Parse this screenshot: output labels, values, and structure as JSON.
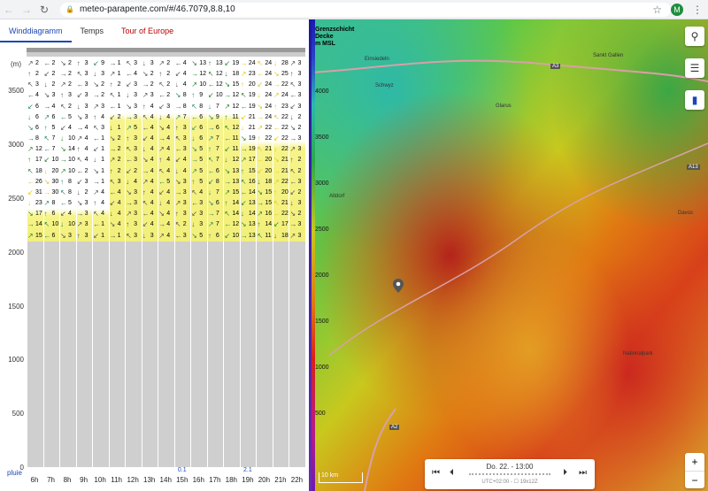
{
  "browser": {
    "url": "meteo-parapente.com/#/46.7079,8.8,10",
    "avatar_letter": "M"
  },
  "tabs": [
    {
      "label": "Winddiagramm",
      "active": true
    },
    {
      "label": "Temps",
      "active": false
    },
    {
      "label": "Tour of Europe",
      "active": false
    }
  ],
  "diagram": {
    "unit": "(m)",
    "y_ticks": [
      "3500",
      "3000",
      "2500",
      "2000",
      "1500",
      "1000",
      "500",
      "0"
    ],
    "pluie_label": "pluie",
    "hours": [
      "6h",
      "7h",
      "8h",
      "9h",
      "10h",
      "11h",
      "12h",
      "13h",
      "14h",
      "15h",
      "16h",
      "17h",
      "18h",
      "19h",
      "20h",
      "21h",
      "22h"
    ],
    "rain": [
      {
        "hour": "15h",
        "value": "0.1"
      },
      {
        "hour": "19h",
        "value": "2.1"
      }
    ],
    "columns": [
      {
        "hour": "6h",
        "speeds": [
          "2",
          "2",
          "3",
          "4",
          "6",
          "6",
          "6",
          "8",
          "12",
          "17",
          "18",
          "26",
          "31",
          "23",
          "17",
          "14",
          "15"
        ]
      },
      {
        "hour": "7h",
        "speeds": [
          "2",
          "2",
          "2",
          "3",
          "4",
          "6",
          "5",
          "7",
          "7",
          "10",
          "20",
          "30",
          "30",
          "8",
          "6",
          "10",
          "6"
        ]
      },
      {
        "hour": "8h",
        "speeds": [
          "2",
          "2",
          "2",
          "3",
          "2",
          "5",
          "4",
          "10",
          "14",
          "10",
          "10",
          "8",
          "8",
          "5",
          "4",
          "10",
          "3"
        ]
      },
      {
        "hour": "9h",
        "speeds": [
          "3",
          "3",
          "3",
          "3",
          "3",
          "3",
          "4",
          "4",
          "4",
          "4",
          "2",
          "3",
          "2",
          "3",
          "3",
          "3",
          "3"
        ]
      },
      {
        "hour": "10h",
        "speeds": [
          "9",
          "3",
          "2",
          "2",
          "3",
          "4",
          "3",
          "1",
          "1",
          "1",
          "1",
          "1",
          "4",
          "4",
          "4",
          "1",
          "1"
        ]
      },
      {
        "hour": "11h",
        "speeds": [
          "1",
          "1",
          "2",
          "1",
          "1",
          "2",
          "1",
          "2",
          "2",
          "2",
          "2",
          "3",
          "4",
          "4",
          "4",
          "4",
          "1"
        ]
      },
      {
        "hour": "12h",
        "speeds": [
          "3",
          "4",
          "3",
          "3",
          "3",
          "3",
          "5",
          "3",
          "3",
          "3",
          "2",
          "4",
          "3",
          "3",
          "3",
          "3",
          "3"
        ]
      },
      {
        "hour": "13h",
        "speeds": [
          "3",
          "2",
          "2",
          "3",
          "4",
          "4",
          "4",
          "4",
          "4",
          "4",
          "4",
          "4",
          "4",
          "4",
          "4",
          "4",
          "3"
        ]
      },
      {
        "hour": "14h",
        "speeds": [
          "2",
          "2",
          "2",
          "2",
          "3",
          "4",
          "4",
          "4",
          "4",
          "4",
          "4",
          "5",
          "4",
          "4",
          "4",
          "4",
          "4"
        ]
      },
      {
        "hour": "15h",
        "speeds": [
          "4",
          "4",
          "4",
          "8",
          "8",
          "7",
          "3",
          "3",
          "3",
          "4",
          "4",
          "3",
          "3",
          "3",
          "3",
          "2",
          "3"
        ]
      },
      {
        "hour": "16h",
        "speeds": [
          "13",
          "12",
          "10",
          "9",
          "8",
          "6",
          "6",
          "6",
          "5",
          "5",
          "5",
          "5",
          "4",
          "3",
          "3",
          "3",
          "5"
        ]
      },
      {
        "hour": "17h",
        "speeds": [
          "13",
          "12",
          "12",
          "10",
          "7",
          "9",
          "6",
          "7",
          "7",
          "7",
          "6",
          "8",
          "7",
          "6",
          "7",
          "7",
          "6"
        ]
      },
      {
        "hour": "18h",
        "speeds": [
          "19",
          "18",
          "15",
          "12",
          "12",
          "11",
          "12",
          "11",
          "11",
          "12",
          "13",
          "13",
          "15",
          "14",
          "14",
          "12",
          "10"
        ]
      },
      {
        "hour": "19h",
        "speeds": [
          "24",
          "23",
          "20",
          "19",
          "19",
          "21",
          "21",
          "19",
          "19",
          "17",
          "15",
          "16",
          "14",
          "13",
          "14",
          "13",
          "13"
        ]
      },
      {
        "hour": "20h",
        "speeds": [
          "24",
          "24",
          "24",
          "24",
          "24",
          "24",
          "22",
          "22",
          "21",
          "20",
          "20",
          "18",
          "15",
          "15",
          "16",
          "14",
          "11"
        ]
      },
      {
        "hour": "21h",
        "speeds": [
          "28",
          "25",
          "22",
          "24",
          "23",
          "22",
          "22",
          "22",
          "22",
          "21",
          "21",
          "22",
          "20",
          "21",
          "22",
          "17",
          "18"
        ]
      },
      {
        "hour": "22h",
        "speeds": [
          "3",
          "3",
          "3",
          "3",
          "3",
          "2",
          "2",
          "3",
          "3",
          "2",
          "2",
          "3",
          "2",
          "3",
          "2",
          "3",
          "3"
        ]
      }
    ]
  },
  "map": {
    "legend_title_line1": "Grenzschicht",
    "legend_title_line2": "Decke",
    "legend_title_line3": "m MSL",
    "legend_values": [
      "4000",
      "3500",
      "3000",
      "2500",
      "2000",
      "1500",
      "1000",
      "500"
    ],
    "places": [
      {
        "name": "Einsiedeln"
      },
      {
        "name": "Sankt Gallen"
      },
      {
        "name": "Schwyz"
      },
      {
        "name": "Glarus"
      },
      {
        "name": "Altdorf"
      },
      {
        "name": "Nationalpark"
      },
      {
        "name": "Davos"
      }
    ],
    "road_labels": [
      "A3",
      "A13",
      "A2"
    ],
    "player_date": "Do. 22. - 13:00",
    "player_sub": "UTC+02:00 - ☐ 19x12Z",
    "scale_label": "10 km",
    "zoom_in": "+",
    "zoom_out": "−"
  },
  "colors": {
    "active_tab": "#1a47b8",
    "tour_tab": "#bb0000",
    "rain": "#1a47b8"
  }
}
